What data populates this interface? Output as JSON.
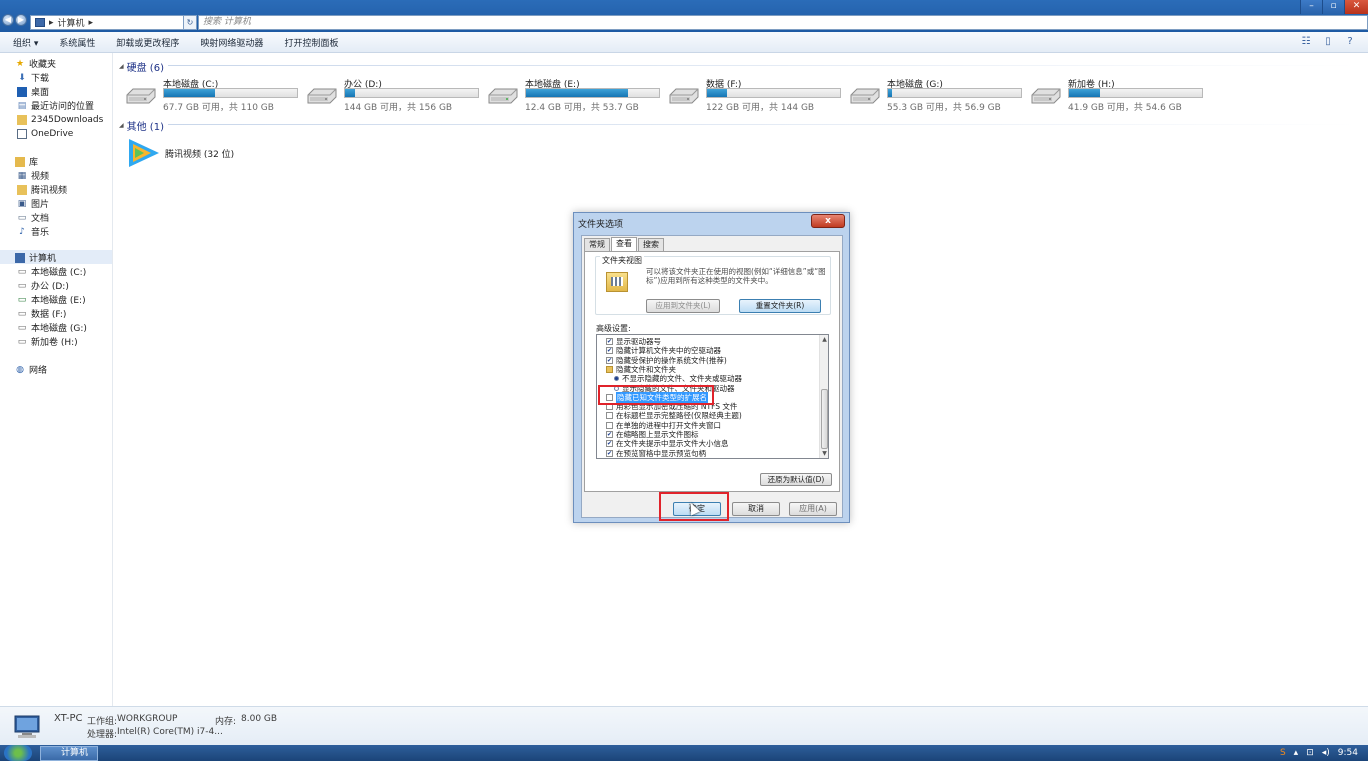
{
  "window": {
    "breadcrumb": [
      "计算机"
    ],
    "search_placeholder": "搜索 计算机",
    "controls": [
      "minimize",
      "maximize",
      "close"
    ]
  },
  "toolbar": {
    "items": [
      {
        "label": "组织 ▾"
      },
      {
        "label": "系统属性"
      },
      {
        "label": "卸载或更改程序"
      },
      {
        "label": "映射网络驱动器"
      },
      {
        "label": "打开控制面板"
      }
    ]
  },
  "sidebar": {
    "favorites": {
      "label": "收藏夹",
      "items": [
        {
          "label": "下载",
          "icon": "download-folder-icon"
        },
        {
          "label": "桌面",
          "icon": "desktop-icon"
        },
        {
          "label": "最近访问的位置",
          "icon": "recent-places-icon"
        },
        {
          "label": "2345Downloads",
          "icon": "folder-icon"
        },
        {
          "label": "OneDrive",
          "icon": "onedrive-icon"
        }
      ]
    },
    "libraries": {
      "label": "库",
      "items": [
        {
          "label": "视频"
        },
        {
          "label": "腾讯视频"
        },
        {
          "label": "图片"
        },
        {
          "label": "文档"
        },
        {
          "label": "音乐"
        }
      ]
    },
    "computer": {
      "label": "计算机",
      "items": [
        {
          "label": "本地磁盘 (C:)"
        },
        {
          "label": "办公 (D:)"
        },
        {
          "label": "本地磁盘 (E:)"
        },
        {
          "label": "数据 (F:)"
        },
        {
          "label": "本地磁盘 (G:)"
        },
        {
          "label": "新加卷 (H:)"
        }
      ]
    },
    "network": {
      "label": "网络"
    }
  },
  "main": {
    "hard_disks_title": "硬盘 (6)",
    "other_title": "其他 (1)",
    "drives": [
      {
        "name": "本地磁盘 (C:)",
        "free": "67.7 GB 可用，共 110 GB",
        "used_fraction": 0.385
      },
      {
        "name": "办公 (D:)",
        "free": "144 GB 可用，共 156 GB",
        "used_fraction": 0.077
      },
      {
        "name": "本地磁盘 (E:)",
        "free": "12.4 GB 可用，共 53.7 GB",
        "used_fraction": 0.769
      },
      {
        "name": "数据 (F:)",
        "free": "122 GB 可用，共 144 GB",
        "used_fraction": 0.153
      },
      {
        "name": "本地磁盘 (G:)",
        "free": "55.3 GB 可用，共 56.9 GB",
        "used_fraction": 0.028
      },
      {
        "name": "新加卷 (H:)",
        "free": "41.9 GB 可用，共 54.6 GB",
        "used_fraction": 0.233
      }
    ],
    "other_items": [
      {
        "label": "腾讯视频 (32 位)"
      }
    ]
  },
  "details": {
    "pc_name": "XT-PC",
    "workgroup_label": "工作组:",
    "workgroup": "WORKGROUP",
    "memory_label": "内存:",
    "memory": "8.00 GB",
    "cpu_label": "处理器:",
    "cpu": "Intel(R) Core(TM) i7-4..."
  },
  "taskbar": {
    "task_label": "计算机",
    "time": "9:54"
  },
  "dialog": {
    "title": "文件夹选项",
    "close_label": "x",
    "tabs": [
      {
        "label": "常规"
      },
      {
        "label": "查看"
      },
      {
        "label": "搜索"
      }
    ],
    "folder_views_label": "文件夹视图",
    "folder_views_desc": "可以将该文件夹正在使用的视图(例如“详细信息”或“图标”)应用到所有这种类型的文件夹中。",
    "apply_to_folders": "应用到文件夹(L)",
    "reset_folders": "重置文件夹(R)",
    "advanced_label": "高级设置:",
    "advanced_items": [
      {
        "type": "check",
        "checked": true,
        "label": "显示驱动器号",
        "indent": 0
      },
      {
        "type": "check",
        "checked": true,
        "label": "隐藏计算机文件夹中的空驱动器",
        "indent": 0
      },
      {
        "type": "check",
        "checked": true,
        "label": "隐藏受保护的操作系统文件(推荐)",
        "indent": 0
      },
      {
        "type": "folder",
        "label": "隐藏文件和文件夹",
        "indent": 0
      },
      {
        "type": "radio",
        "checked": true,
        "label": "不显示隐藏的文件、文件夹或驱动器",
        "indent": 1
      },
      {
        "type": "radio",
        "checked": false,
        "label": "显示隐藏的文件、文件夹和驱动器",
        "indent": 1
      },
      {
        "type": "check",
        "checked": false,
        "label": "隐藏已知文件类型的扩展名",
        "indent": 0,
        "selected": true
      },
      {
        "type": "check",
        "checked": false,
        "label": "用彩色显示加密或压缩的 NTFS 文件",
        "indent": 0
      },
      {
        "type": "check",
        "checked": false,
        "label": "在标题栏显示完整路径(仅限经典主题)",
        "indent": 0
      },
      {
        "type": "check",
        "checked": false,
        "label": "在单独的进程中打开文件夹窗口",
        "indent": 0
      },
      {
        "type": "check",
        "checked": true,
        "label": "在缩略图上显示文件图标",
        "indent": 0
      },
      {
        "type": "check",
        "checked": true,
        "label": "在文件夹提示中显示文件大小信息",
        "indent": 0
      },
      {
        "type": "check",
        "checked": true,
        "label": "在预览窗格中显示预览句柄",
        "indent": 0
      }
    ],
    "restore_defaults": "还原为默认值(D)",
    "ok": "确定",
    "cancel": "取消",
    "apply": "应用(A)"
  }
}
